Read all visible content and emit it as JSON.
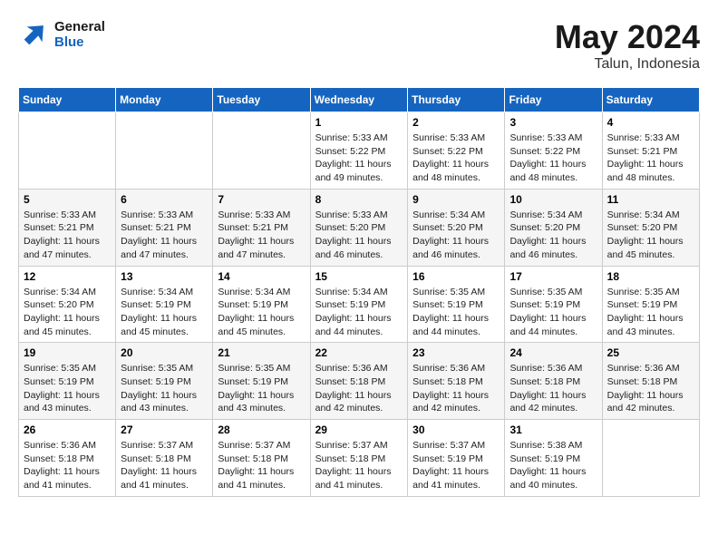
{
  "header": {
    "logo_line1": "General",
    "logo_line2": "Blue",
    "month": "May 2024",
    "location": "Talun, Indonesia"
  },
  "days_of_week": [
    "Sunday",
    "Monday",
    "Tuesday",
    "Wednesday",
    "Thursday",
    "Friday",
    "Saturday"
  ],
  "weeks": [
    [
      {
        "day": "",
        "info": ""
      },
      {
        "day": "",
        "info": ""
      },
      {
        "day": "",
        "info": ""
      },
      {
        "day": "1",
        "info": "Sunrise: 5:33 AM\nSunset: 5:22 PM\nDaylight: 11 hours\nand 49 minutes."
      },
      {
        "day": "2",
        "info": "Sunrise: 5:33 AM\nSunset: 5:22 PM\nDaylight: 11 hours\nand 48 minutes."
      },
      {
        "day": "3",
        "info": "Sunrise: 5:33 AM\nSunset: 5:22 PM\nDaylight: 11 hours\nand 48 minutes."
      },
      {
        "day": "4",
        "info": "Sunrise: 5:33 AM\nSunset: 5:21 PM\nDaylight: 11 hours\nand 48 minutes."
      }
    ],
    [
      {
        "day": "5",
        "info": "Sunrise: 5:33 AM\nSunset: 5:21 PM\nDaylight: 11 hours\nand 47 minutes."
      },
      {
        "day": "6",
        "info": "Sunrise: 5:33 AM\nSunset: 5:21 PM\nDaylight: 11 hours\nand 47 minutes."
      },
      {
        "day": "7",
        "info": "Sunrise: 5:33 AM\nSunset: 5:21 PM\nDaylight: 11 hours\nand 47 minutes."
      },
      {
        "day": "8",
        "info": "Sunrise: 5:33 AM\nSunset: 5:20 PM\nDaylight: 11 hours\nand 46 minutes."
      },
      {
        "day": "9",
        "info": "Sunrise: 5:34 AM\nSunset: 5:20 PM\nDaylight: 11 hours\nand 46 minutes."
      },
      {
        "day": "10",
        "info": "Sunrise: 5:34 AM\nSunset: 5:20 PM\nDaylight: 11 hours\nand 46 minutes."
      },
      {
        "day": "11",
        "info": "Sunrise: 5:34 AM\nSunset: 5:20 PM\nDaylight: 11 hours\nand 45 minutes."
      }
    ],
    [
      {
        "day": "12",
        "info": "Sunrise: 5:34 AM\nSunset: 5:20 PM\nDaylight: 11 hours\nand 45 minutes."
      },
      {
        "day": "13",
        "info": "Sunrise: 5:34 AM\nSunset: 5:19 PM\nDaylight: 11 hours\nand 45 minutes."
      },
      {
        "day": "14",
        "info": "Sunrise: 5:34 AM\nSunset: 5:19 PM\nDaylight: 11 hours\nand 45 minutes."
      },
      {
        "day": "15",
        "info": "Sunrise: 5:34 AM\nSunset: 5:19 PM\nDaylight: 11 hours\nand 44 minutes."
      },
      {
        "day": "16",
        "info": "Sunrise: 5:35 AM\nSunset: 5:19 PM\nDaylight: 11 hours\nand 44 minutes."
      },
      {
        "day": "17",
        "info": "Sunrise: 5:35 AM\nSunset: 5:19 PM\nDaylight: 11 hours\nand 44 minutes."
      },
      {
        "day": "18",
        "info": "Sunrise: 5:35 AM\nSunset: 5:19 PM\nDaylight: 11 hours\nand 43 minutes."
      }
    ],
    [
      {
        "day": "19",
        "info": "Sunrise: 5:35 AM\nSunset: 5:19 PM\nDaylight: 11 hours\nand 43 minutes."
      },
      {
        "day": "20",
        "info": "Sunrise: 5:35 AM\nSunset: 5:19 PM\nDaylight: 11 hours\nand 43 minutes."
      },
      {
        "day": "21",
        "info": "Sunrise: 5:35 AM\nSunset: 5:19 PM\nDaylight: 11 hours\nand 43 minutes."
      },
      {
        "day": "22",
        "info": "Sunrise: 5:36 AM\nSunset: 5:18 PM\nDaylight: 11 hours\nand 42 minutes."
      },
      {
        "day": "23",
        "info": "Sunrise: 5:36 AM\nSunset: 5:18 PM\nDaylight: 11 hours\nand 42 minutes."
      },
      {
        "day": "24",
        "info": "Sunrise: 5:36 AM\nSunset: 5:18 PM\nDaylight: 11 hours\nand 42 minutes."
      },
      {
        "day": "25",
        "info": "Sunrise: 5:36 AM\nSunset: 5:18 PM\nDaylight: 11 hours\nand 42 minutes."
      }
    ],
    [
      {
        "day": "26",
        "info": "Sunrise: 5:36 AM\nSunset: 5:18 PM\nDaylight: 11 hours\nand 41 minutes."
      },
      {
        "day": "27",
        "info": "Sunrise: 5:37 AM\nSunset: 5:18 PM\nDaylight: 11 hours\nand 41 minutes."
      },
      {
        "day": "28",
        "info": "Sunrise: 5:37 AM\nSunset: 5:18 PM\nDaylight: 11 hours\nand 41 minutes."
      },
      {
        "day": "29",
        "info": "Sunrise: 5:37 AM\nSunset: 5:18 PM\nDaylight: 11 hours\nand 41 minutes."
      },
      {
        "day": "30",
        "info": "Sunrise: 5:37 AM\nSunset: 5:19 PM\nDaylight: 11 hours\nand 41 minutes."
      },
      {
        "day": "31",
        "info": "Sunrise: 5:38 AM\nSunset: 5:19 PM\nDaylight: 11 hours\nand 40 minutes."
      },
      {
        "day": "",
        "info": ""
      }
    ]
  ]
}
